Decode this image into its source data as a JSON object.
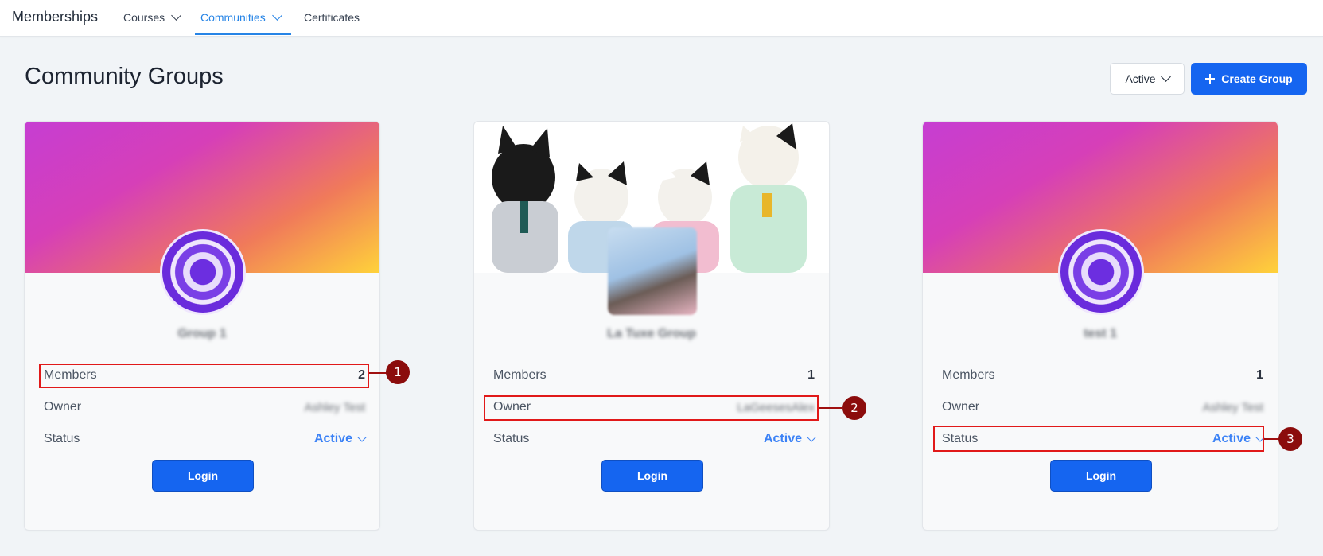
{
  "nav": {
    "brand": "Memberships",
    "items": [
      {
        "label": "Courses"
      },
      {
        "label": "Communities"
      },
      {
        "label": "Certificates"
      }
    ]
  },
  "header": {
    "title": "Community Groups",
    "filter_label": "Active",
    "create_label": "Create Group"
  },
  "cards": [
    {
      "group_name": "Group 1",
      "members_label": "Members",
      "members_value": "2",
      "owner_label": "Owner",
      "owner_value": "Ashley Test",
      "status_label": "Status",
      "status_value": "Active",
      "login_label": "Login",
      "banner": "gradient"
    },
    {
      "group_name": "La Tuxe Group",
      "members_label": "Members",
      "members_value": "1",
      "owner_label": "Owner",
      "owner_value": "LaGeesesAlex",
      "status_label": "Status",
      "status_value": "Active",
      "login_label": "Login",
      "banner": "photo"
    },
    {
      "group_name": "test 1",
      "members_label": "Members",
      "members_value": "1",
      "owner_label": "Owner",
      "owner_value": "Ashley Test",
      "status_label": "Status",
      "status_value": "Active",
      "login_label": "Login",
      "banner": "gradient"
    }
  ],
  "annotations": [
    "1",
    "2",
    "3"
  ],
  "colors": {
    "accent": "#1565f0",
    "nav_active": "#2684e6",
    "highlight": "#e11919",
    "marker": "#8b0c0c"
  }
}
